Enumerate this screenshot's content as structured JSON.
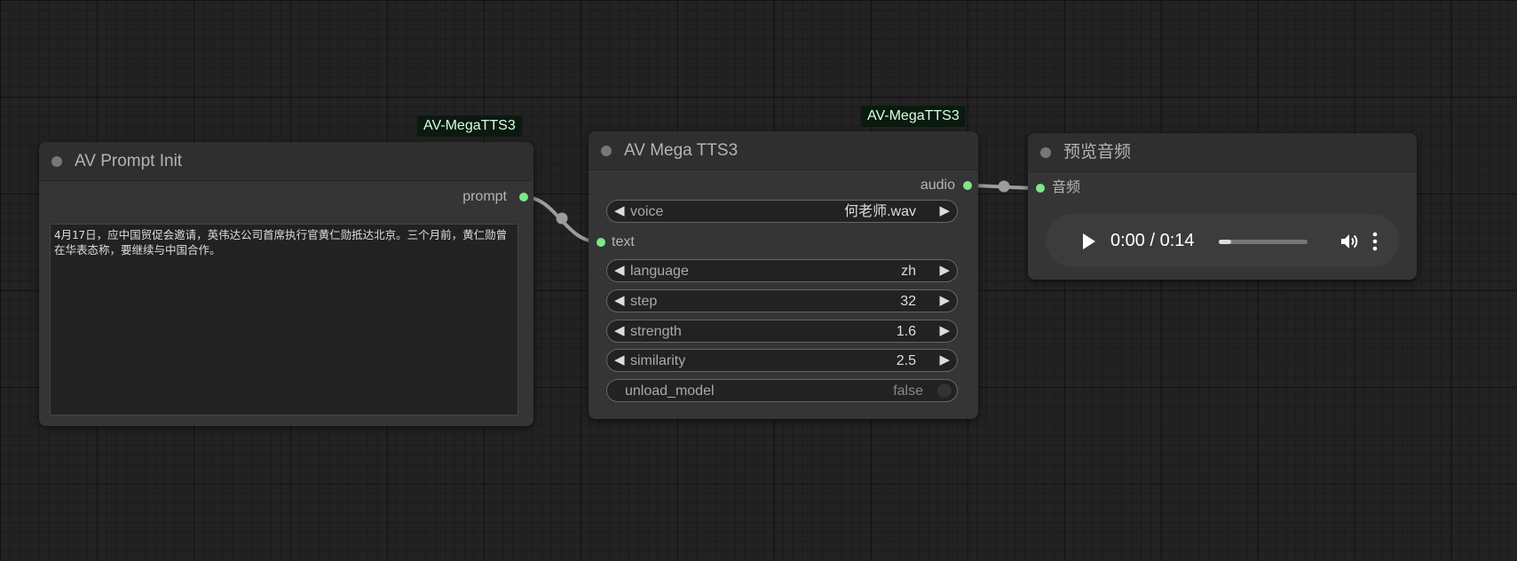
{
  "nodes": {
    "prompt_init": {
      "badge": "AV-MegaTTS3",
      "title": "AV Prompt Init",
      "output_label": "prompt",
      "text": "4月17日，应中国贸促会邀请，英伟达公司首席执行官黄仁勋抵达北京。三个月前，黄仁勋曾在华表态称，要继续与中国合作。"
    },
    "mega_tts": {
      "badge": "AV-MegaTTS3",
      "title": "AV Mega TTS3",
      "output_label": "audio",
      "input_label": "text",
      "widgets": [
        {
          "label": "voice",
          "value": "何老师.wav"
        },
        {
          "label": "language",
          "value": "zh"
        },
        {
          "label": "step",
          "value": "32"
        },
        {
          "label": "strength",
          "value": "1.6"
        },
        {
          "label": "similarity",
          "value": "2.5"
        }
      ],
      "toggle": {
        "label": "unload_model",
        "value": "false"
      }
    },
    "preview_audio": {
      "title": "预览音频",
      "input_label": "音频",
      "player": {
        "time": "0:00 / 0:14",
        "progress_fraction": 0.14
      }
    }
  },
  "icons": {
    "play": "play-icon",
    "volume": "volume-icon",
    "menu": "more-vertical-icon"
  },
  "colors": {
    "slot_connected": "#7ee787",
    "link": "#9a9f9a",
    "badge_bg": "#0a1a10"
  }
}
